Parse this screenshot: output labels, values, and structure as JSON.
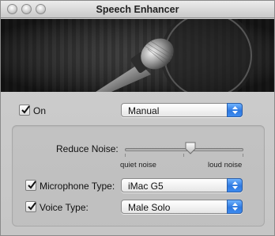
{
  "window": {
    "title": "Speech Enhancer"
  },
  "controls": {
    "on": {
      "label": "On",
      "checked": true,
      "preset_value": "Manual"
    },
    "reduce_noise": {
      "label": "Reduce Noise:",
      "min_label": "quiet noise",
      "max_label": "loud noise",
      "level": 0.55
    },
    "microphone_type": {
      "label": "Microphone Type:",
      "checked": true,
      "value": "iMac G5"
    },
    "voice_type": {
      "label": "Voice Type:",
      "checked": true,
      "value": "Male Solo"
    }
  },
  "colors": {
    "accent": "#2f79e0",
    "window_bg": "#c9c9c9",
    "hero_bg": "#2e2e2e"
  },
  "icons": [
    "close-button",
    "minimize-button",
    "zoom-button",
    "checkmark-icon",
    "popup-arrows-icon",
    "microphone-illustration"
  ]
}
